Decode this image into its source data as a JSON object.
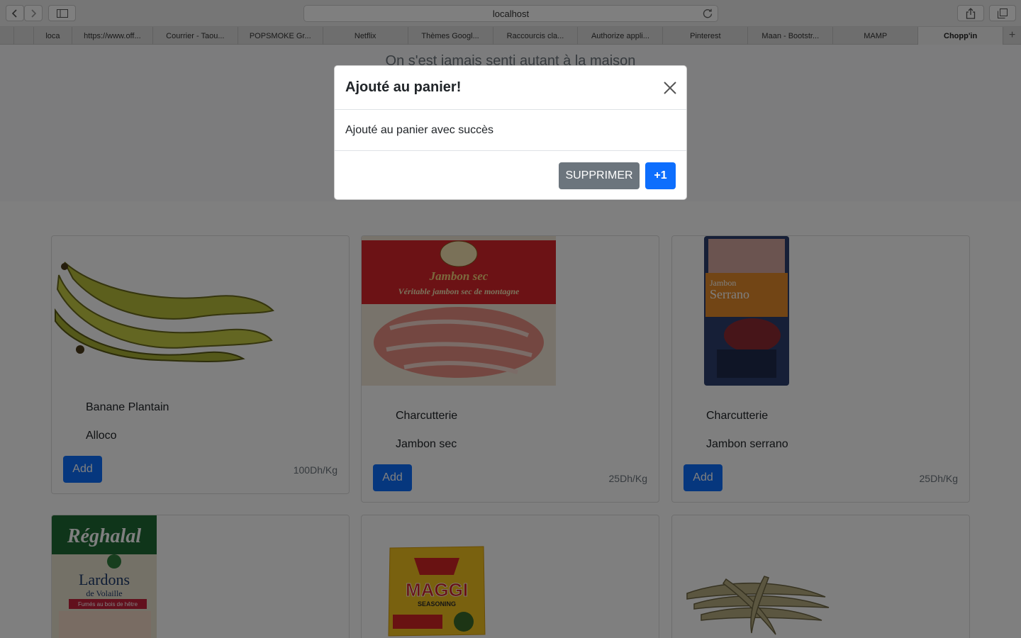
{
  "browser": {
    "address": "localhost",
    "tabs": [
      {
        "label": "loca",
        "active": false
      },
      {
        "label": "https://www.off...",
        "active": false
      },
      {
        "label": "Courrier - Taou...",
        "active": false
      },
      {
        "label": "POPSMOKE Gr...",
        "active": false
      },
      {
        "label": "Netflix",
        "active": false
      },
      {
        "label": "Thèmes Googl...",
        "active": false
      },
      {
        "label": "Raccourcis cla...",
        "active": false
      },
      {
        "label": "Authorize appli...",
        "active": false
      },
      {
        "label": "Pinterest",
        "active": false
      },
      {
        "label": "Maan - Bootstr...",
        "active": false
      },
      {
        "label": "MAMP",
        "active": false
      },
      {
        "label": "Chopp'in",
        "active": true
      }
    ]
  },
  "hero": {
    "text": "On s'est jamais senti autant à la maison"
  },
  "products": [
    {
      "line1": "Banane Plantain",
      "line2": "Alloco",
      "add_label": "Add",
      "price": "100Dh/Kg",
      "image": "plantain-bananas-image"
    },
    {
      "line1": "Charcutterie",
      "line2": "Jambon sec",
      "add_label": "Add",
      "price": "25Dh/Kg",
      "image": "jambon-sec-package-image"
    },
    {
      "line1": "Charcutterie",
      "line2": "Jambon serrano",
      "add_label": "Add",
      "price": "25Dh/Kg",
      "image": "jambon-serrano-package-image"
    },
    {
      "image": "lardons-package-image",
      "brand": "Réghalal",
      "product": "Lardons",
      "subtitle": "de Volaille",
      "note": "Fumés au bois de hêtre"
    },
    {
      "image": "maggi-seasoning-image",
      "brand": "MAGGI",
      "note": "SEASONING"
    },
    {
      "image": "dried-beans-image"
    }
  ],
  "modal": {
    "title": "Ajouté au panier!",
    "body": "Ajouté au panier avec succès",
    "delete_label": "SUPPRIMER",
    "plus_label": "+1"
  },
  "colors": {
    "primary": "#0d6efd",
    "secondary": "#6c757d",
    "overlay": "rgba(0,0,0,0.5)"
  }
}
